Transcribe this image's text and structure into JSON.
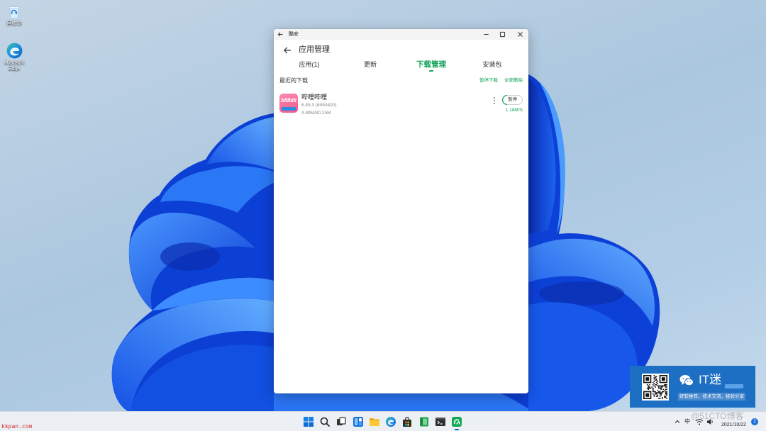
{
  "desktop": {
    "icons": [
      {
        "label": "回收站",
        "icon": "recycle-bin-icon"
      },
      {
        "label": "Microsoft Edge",
        "icon": "edge-icon"
      }
    ]
  },
  "window": {
    "title": "酷安",
    "controls": [
      "minimize-icon",
      "maximize-icon",
      "close-icon"
    ]
  },
  "app": {
    "page_title": "应用管理",
    "tabs": [
      {
        "label": "应用(1)",
        "active": false
      },
      {
        "label": "更新",
        "active": false
      },
      {
        "label": "下载管理",
        "active": true
      },
      {
        "label": "安装包",
        "active": false
      }
    ],
    "section_title": "最近的下载",
    "pause_all_label": "暂停下载",
    "delete_all_label": "全部删除",
    "downloads": [
      {
        "name": "哔哩哔哩",
        "logo_text": "bilibili",
        "version": "6.45.0 (6450400)",
        "size_progress": "4.89M/80.25M",
        "speed": "1.18M/S",
        "action_label": "暂停",
        "menu_icon": "more-vertical-icon"
      }
    ]
  },
  "colors": {
    "accent": "#12a35b",
    "taskbar_active": "#0a64d0",
    "promo_bg": "#1d6fc4",
    "watermark_site": "#d42a2a"
  },
  "taskbar": {
    "apps": [
      "start-icon",
      "search-icon",
      "task-view-icon",
      "widgets-icon",
      "file-explorer-icon",
      "edge-icon",
      "store-icon",
      "green-app-icon",
      "terminal-icon",
      "coolapk-icon"
    ],
    "active_app": "coolapk-icon"
  },
  "tray": {
    "ime_label": "中",
    "date": "2021/10/22",
    "notification_count": "2"
  },
  "promo": {
    "title": "IT迷",
    "subtitle": "好软推荐，技术交流，经验分享"
  },
  "watermarks": {
    "site": "kkpan.com",
    "blog": "@51CTO博客"
  }
}
